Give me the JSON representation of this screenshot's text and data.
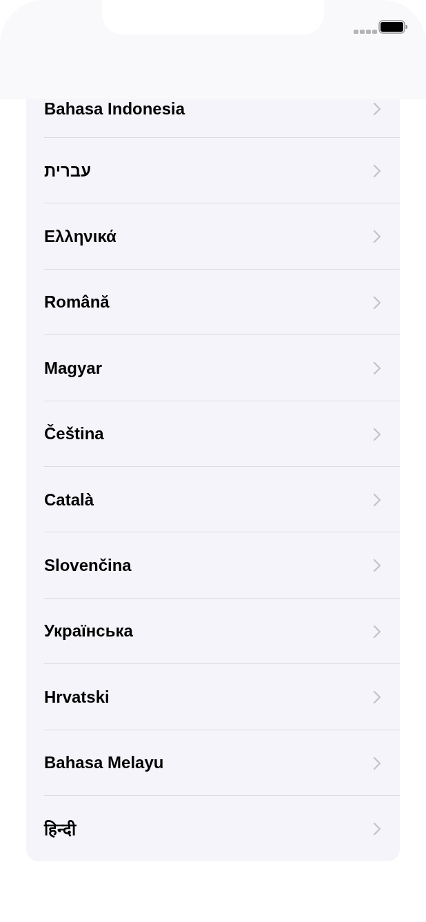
{
  "languages": [
    {
      "label": "Bahasa Indonesia"
    },
    {
      "label": "עברית"
    },
    {
      "label": "Ελληνικά"
    },
    {
      "label": "Română"
    },
    {
      "label": "Magyar"
    },
    {
      "label": "Čeština"
    },
    {
      "label": "Català"
    },
    {
      "label": "Slovenčina"
    },
    {
      "label": "Українська"
    },
    {
      "label": "Hrvatski"
    },
    {
      "label": "Bahasa Melayu"
    },
    {
      "label": "हिन्दी"
    }
  ]
}
